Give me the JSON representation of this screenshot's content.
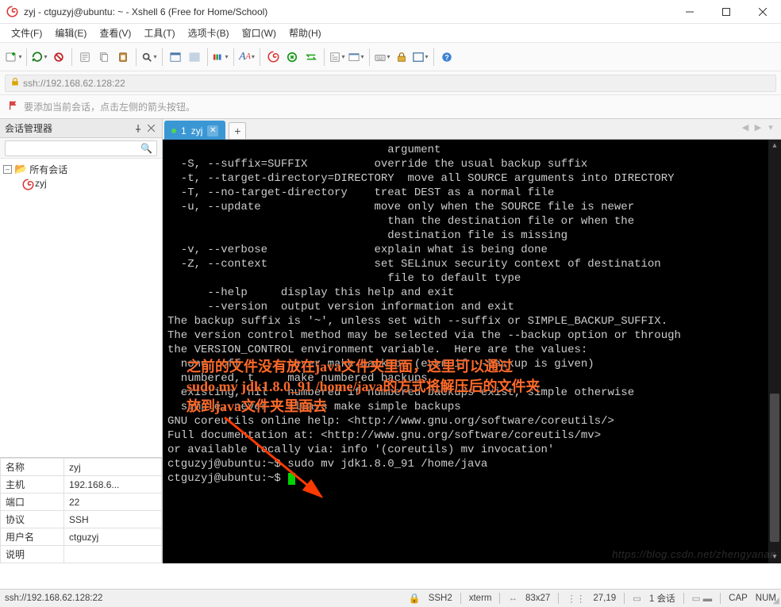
{
  "window": {
    "title": "zyj - ctguzyj@ubuntu: ~ - Xshell 6 (Free for Home/School)"
  },
  "menu": {
    "file": "文件(F)",
    "edit": "编辑(E)",
    "view": "查看(V)",
    "tools": "工具(T)",
    "tabs": "选项卡(B)",
    "window": "窗口(W)",
    "help": "帮助(H)"
  },
  "address": {
    "url": "ssh://192.168.62.128:22"
  },
  "hint": {
    "text": "要添加当前会话，点击左侧的箭头按钮。"
  },
  "sidebar": {
    "title": "会话管理器",
    "search_placeholder": "",
    "root": "所有会话",
    "session": "zyj"
  },
  "props": {
    "name_k": "名称",
    "name_v": "zyj",
    "host_k": "主机",
    "host_v": "192.168.6...",
    "port_k": "端口",
    "port_v": "22",
    "proto_k": "协议",
    "proto_v": "SSH",
    "user_k": "用户名",
    "user_v": "ctguzyj",
    "desc_k": "说明",
    "desc_v": ""
  },
  "tab": {
    "index": "1",
    "label": "zyj"
  },
  "terminal": {
    "lines": [
      "                                 argument",
      "  -S, --suffix=SUFFIX          override the usual backup suffix",
      "  -t, --target-directory=DIRECTORY  move all SOURCE arguments into DIRECTORY",
      "  -T, --no-target-directory    treat DEST as a normal file",
      "  -u, --update                 move only when the SOURCE file is newer",
      "                                 than the destination file or when the",
      "                                 destination file is missing",
      "  -v, --verbose                explain what is being done",
      "  -Z, --context                set SELinux security context of destination",
      "                                 file to default type",
      "      --help     display this help and exit",
      "      --version  output version information and exit",
      "",
      "The backup suffix is '~', unless set with --suffix or SIMPLE_BACKUP_SUFFIX.",
      "The version control method may be selected via the --backup option or through",
      "the VERSION_CONTROL environment variable.  Here are the values:",
      "",
      "  none, off       never make backups (even if --backup is given)",
      "  numbered, t     make numbered backups",
      "  existing, nil   numbered if numbered backups exist, simple otherwise",
      "  simple, never   always make simple backups",
      "",
      "GNU coreutils online help: <http://www.gnu.org/software/coreutils/>",
      "Full documentation at: <http://www.gnu.org/software/coreutils/mv>",
      "or available locally via: info '(coreutils) mv invocation'",
      "ctguzyj@ubuntu:~$ sudo mv jdk1.8.0_91 /home/java",
      "ctguzyj@ubuntu:~$ "
    ]
  },
  "overlay": {
    "line1": "之前的文件没有放在java文件夹里面，这里可以通过",
    "line2": "sudo mv jdk1.8.0_91 /home/java的方式将解压后的文件夹",
    "line3": "放到java文件夹里面去"
  },
  "status": {
    "conn": "ssh://192.168.62.128:22",
    "proto": "SSH2",
    "term": "xterm",
    "size": "83x27",
    "pos": "27,19",
    "sess_label": "1 会话",
    "sess_icon_count": "",
    "cap": "CAP",
    "num": "NUM"
  },
  "watermark": "https://blog.csdn.net/zhengyanan"
}
